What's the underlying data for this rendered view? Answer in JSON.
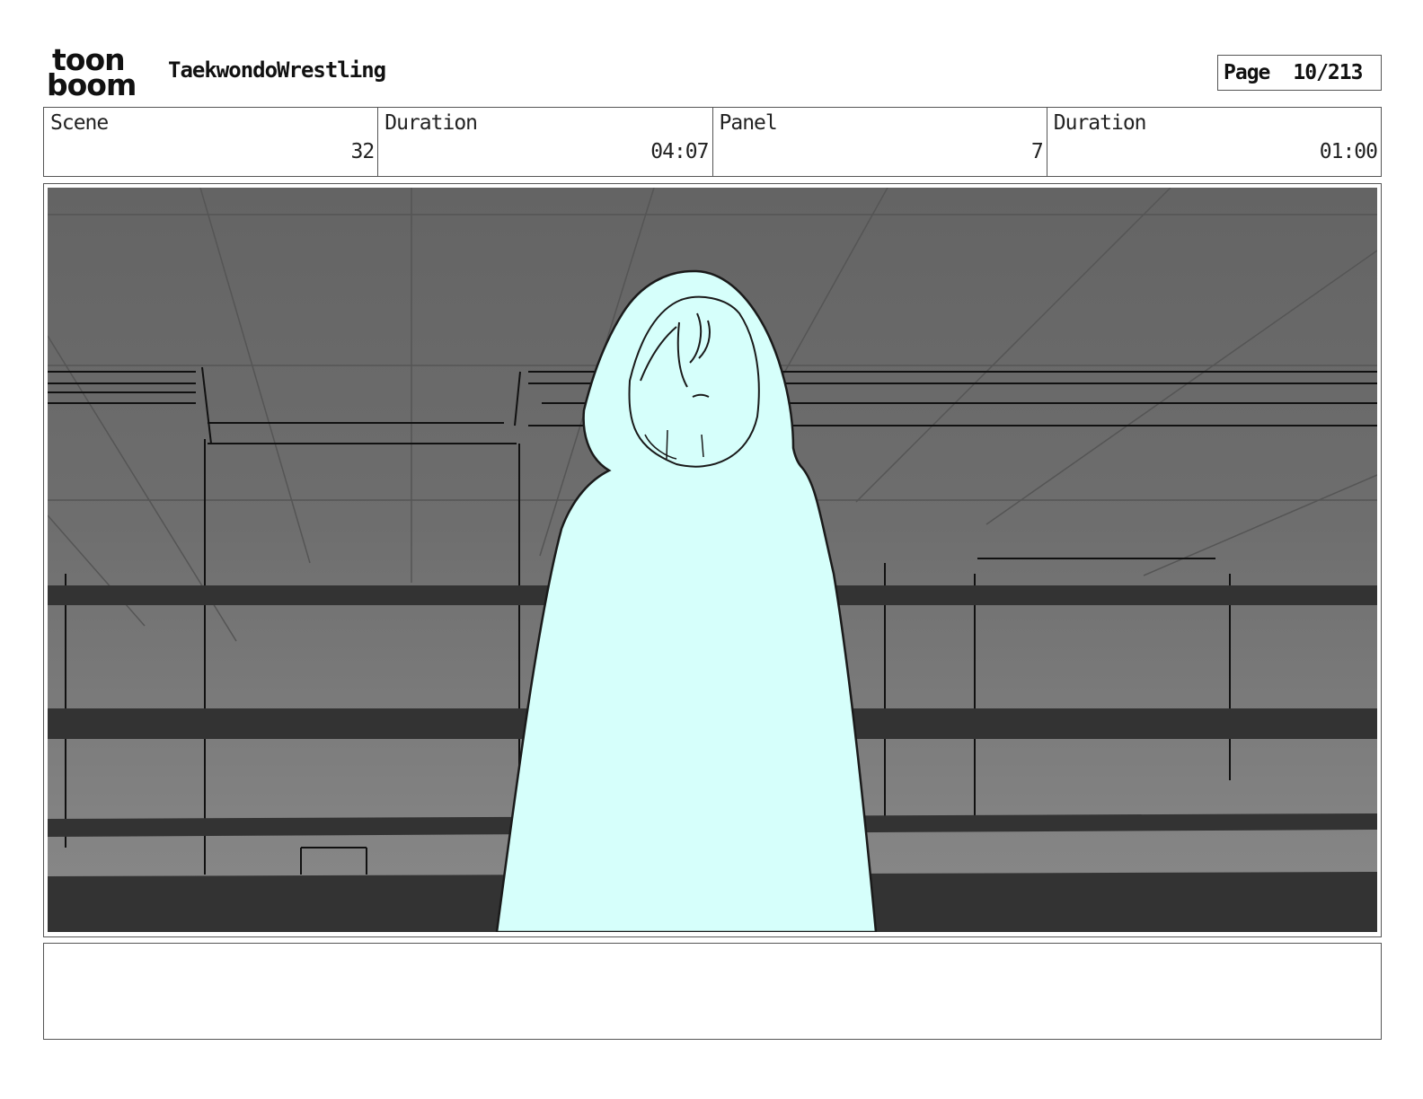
{
  "header": {
    "logo_top": "toon",
    "logo_bottom": "boom",
    "project_title": "TaekwondoWrestling",
    "page_label": "Page",
    "page_value": "10/213"
  },
  "info": {
    "scene_label": "Scene",
    "scene_value": "32",
    "scene_duration_label": "Duration",
    "scene_duration_value": "04:07",
    "panel_label": "Panel",
    "panel_value": "7",
    "panel_duration_label": "Duration",
    "panel_duration_value": "01:00"
  },
  "panel_image": {
    "figure_fill": "#d6fffb",
    "background_fill": "#7a7a7a",
    "bar_fill": "#333333"
  },
  "notes": {
    "text": ""
  }
}
